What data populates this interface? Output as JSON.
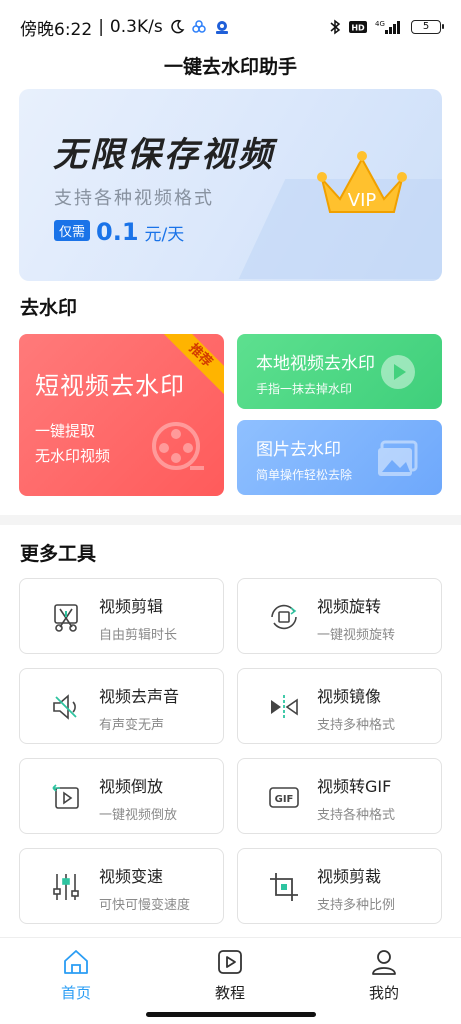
{
  "status_bar": {
    "time": "傍晚6:22",
    "net_speed": "0.3K/s",
    "battery": "5"
  },
  "app_title": "一键去水印助手",
  "banner": {
    "title": "无限保存视频",
    "subtitle": "支持各种视频格式",
    "price_tag": "仅需",
    "price_value": "0.1",
    "price_unit": "元/天",
    "badge": "VIP"
  },
  "watermark_section": {
    "title": "去水印",
    "short_video": {
      "title": "短视频去水印",
      "line1": "一键提取",
      "line2": "无水印视频",
      "ribbon": "推荐"
    },
    "local_video": {
      "title": "本地视频去水印",
      "subtitle": "手指一抹去掉水印"
    },
    "image": {
      "title": "图片去水印",
      "subtitle": "简单操作轻松去除"
    }
  },
  "tools_section": {
    "title": "更多工具",
    "items": [
      {
        "title": "视频剪辑",
        "subtitle": "自由剪辑时长",
        "icon": "scissors-video-icon"
      },
      {
        "title": "视频旋转",
        "subtitle": "一键视频旋转",
        "icon": "rotate-icon"
      },
      {
        "title": "视频去声音",
        "subtitle": "有声变无声",
        "icon": "speaker-mute-icon"
      },
      {
        "title": "视频镜像",
        "subtitle": "支持多种格式",
        "icon": "mirror-icon"
      },
      {
        "title": "视频倒放",
        "subtitle": "一键视频倒放",
        "icon": "reverse-play-icon"
      },
      {
        "title": "视频转GIF",
        "subtitle": "支持各种格式",
        "icon": "gif-icon"
      },
      {
        "title": "视频变速",
        "subtitle": "可快可慢变速度",
        "icon": "sliders-icon"
      },
      {
        "title": "视频剪裁",
        "subtitle": "支持多种比例",
        "icon": "crop-icon"
      }
    ]
  },
  "bottom_nav": {
    "items": [
      {
        "label": "首页",
        "icon": "home-icon",
        "active": true
      },
      {
        "label": "教程",
        "icon": "play-tutorial-icon",
        "active": false
      },
      {
        "label": "我的",
        "icon": "user-icon",
        "active": false
      }
    ]
  },
  "colors": {
    "accent_blue": "#1a73e8",
    "nav_active": "#2a9df4",
    "card_red": "#ff5b5b",
    "card_green": "#3fcf7b",
    "card_blue": "#6ea8fb"
  }
}
